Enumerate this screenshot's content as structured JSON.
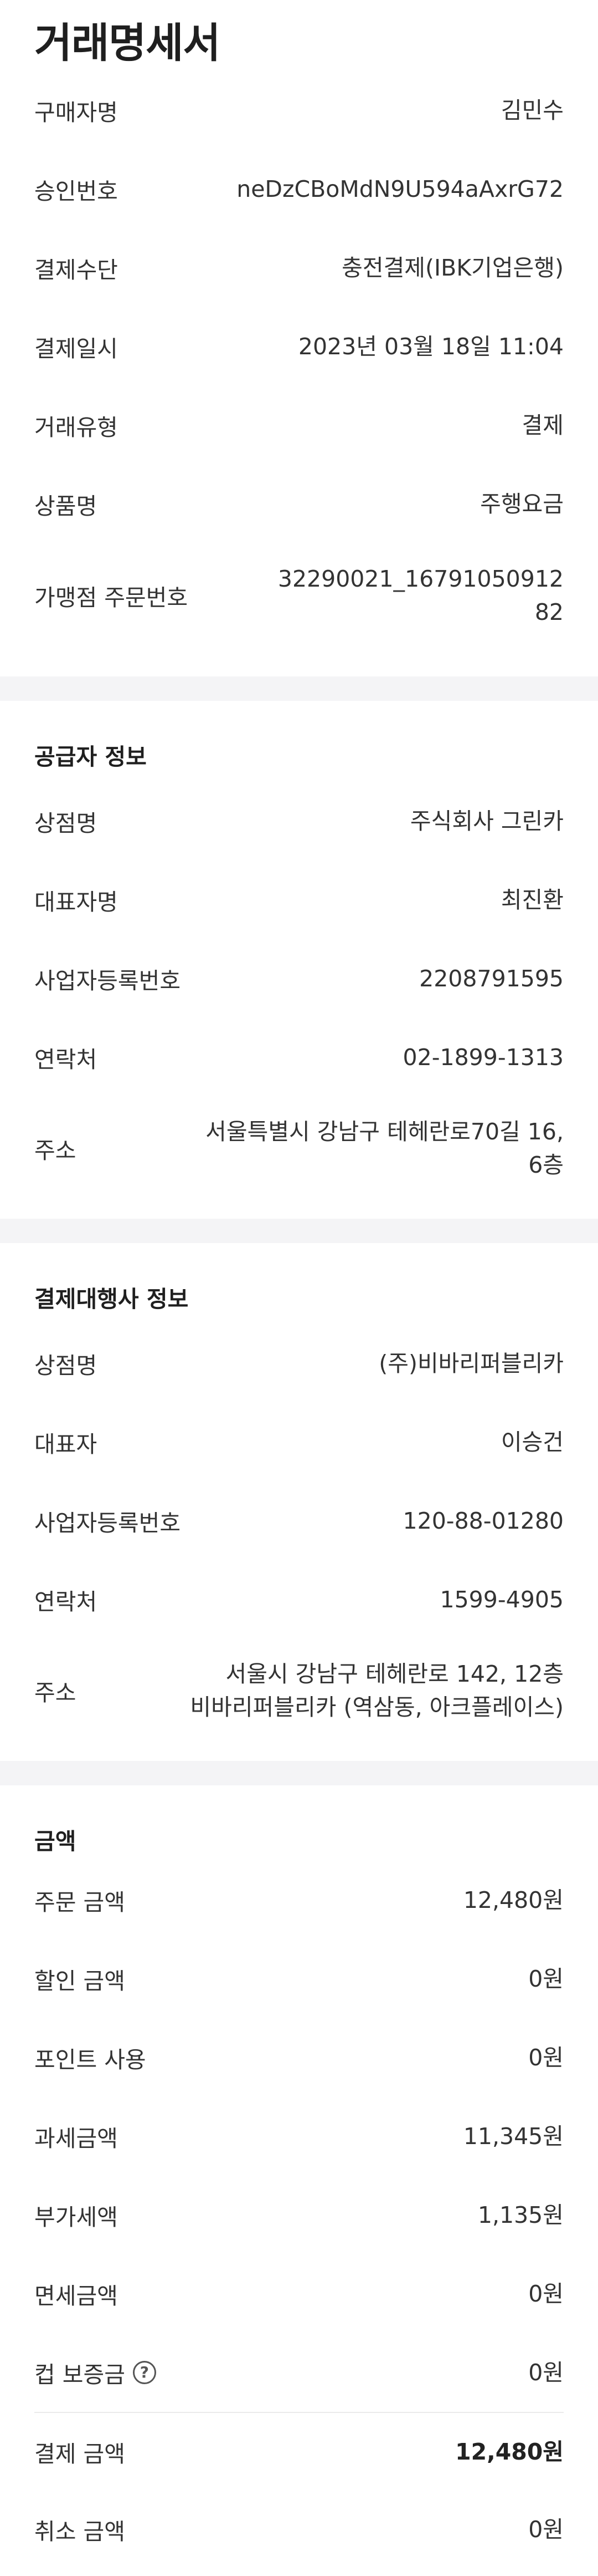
{
  "title": "거래명세서",
  "transaction": {
    "rows": [
      {
        "label": "구매자명",
        "value": "김민수"
      },
      {
        "label": "승인번호",
        "value": "neDzCBoMdN9U594aAxrG72"
      },
      {
        "label": "결제수단",
        "value": "충전결제(IBK기업은행)"
      },
      {
        "label": "결제일시",
        "value": "2023년 03월 18일 11:04"
      },
      {
        "label": "거래유형",
        "value": "결제"
      },
      {
        "label": "상품명",
        "value": "주행요금"
      },
      {
        "label": "가맹점 주문번호",
        "value_line1": "32290021_16791050912",
        "value_line2": "82"
      }
    ]
  },
  "supplier": {
    "header": "공급자 정보",
    "rows": [
      {
        "label": "상점명",
        "value": "주식회사 그린카"
      },
      {
        "label": "대표자명",
        "value": "최진환"
      },
      {
        "label": "사업자등록번호",
        "value": "2208791595"
      },
      {
        "label": "연락처",
        "value": "02-1899-1313"
      },
      {
        "label": "주소",
        "value_line1": "서울특별시 강남구 테헤란로70길 16,",
        "value_line2": "6층"
      }
    ]
  },
  "payment_agency": {
    "header": "결제대행사 정보",
    "rows": [
      {
        "label": "상점명",
        "value": "(주)비바리퍼블리카"
      },
      {
        "label": "대표자",
        "value": "이승건"
      },
      {
        "label": "사업자등록번호",
        "value": "120-88-01280"
      },
      {
        "label": "연락처",
        "value": "1599-4905"
      },
      {
        "label": "주소",
        "value_line1": "서울시 강남구 테헤란로 142, 12층",
        "value_line2": "비바리퍼블리카 (역삼동, 아크플레이스)"
      }
    ]
  },
  "amount": {
    "header": "금액",
    "rows": [
      {
        "label": "주문 금액",
        "value": "12,480원"
      },
      {
        "label": "할인 금액",
        "value": "0원"
      },
      {
        "label": "포인트 사용",
        "value": "0원"
      },
      {
        "label": "과세금액",
        "value": "11,345원"
      },
      {
        "label": "부가세액",
        "value": "1,135원"
      },
      {
        "label": "면세금액",
        "value": "0원"
      },
      {
        "label": "컵 보증금",
        "value": "0원",
        "help_icon": "?"
      },
      {
        "label": "결제 금액",
        "value": "12,480원"
      },
      {
        "label": "취소 금액",
        "value": "0원"
      }
    ]
  }
}
